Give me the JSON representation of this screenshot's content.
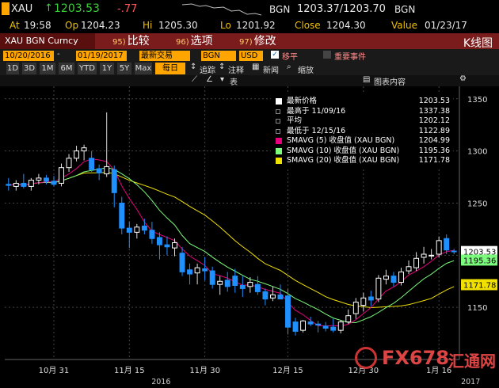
{
  "header": {
    "symbol": "XAU",
    "arrow": "↑",
    "price": "1203.53",
    "change": "-.77",
    "bid_label": "BGN",
    "bid_ask": "1203.37/1203.70",
    "ask_label": "BGN"
  },
  "quote": {
    "at_label": "At",
    "at_value": "19:58",
    "op_label": "Op",
    "op_value": "1204.23",
    "hi_label": "Hi",
    "hi_value": "1205.30",
    "lo_label": "Lo",
    "lo_value": "1201.92",
    "close_label": "Close",
    "close_value": "1204.30",
    "value_label": "Value",
    "value_date": "01/23/17"
  },
  "menu": {
    "security": "XAU BGN Curncy",
    "compare_num": "95)",
    "compare": "比较",
    "options_num": "96)",
    "options": "选项",
    "edit_num": "97)",
    "edit": "修改",
    "right_title": "K线图"
  },
  "settings": {
    "start_date": "10/20/2016",
    "end_date": "01/19/2017",
    "mode": "最新交易",
    "source": "BGN",
    "currency": "USD",
    "shift_label": "移平",
    "events_label": "重要事件"
  },
  "periods": {
    "items": [
      "1D",
      "3D",
      "1M",
      "6M",
      "YTD",
      "1Y",
      "5Y",
      "Max"
    ],
    "freq": "每日",
    "track": "追踪",
    "note": "注释",
    "news": "新闻",
    "zoom": "缩放",
    "table": "表",
    "chart_content": "图表内容"
  },
  "legend": {
    "items": [
      {
        "label": "最新价格",
        "value": "1203.53",
        "color": "#ffffff"
      },
      {
        "label": "最高于 11/09/16",
        "value": "1337.38",
        "color": ""
      },
      {
        "label": "平均",
        "value": "1202.12",
        "color": ""
      },
      {
        "label": "最低于 12/15/16",
        "value": "1122.89",
        "color": ""
      },
      {
        "label": "SMAVG (5) 收盘值 (XAU BGN)",
        "value": "1204.99",
        "color": "#e6007e"
      },
      {
        "label": "SMAVG (10) 收盘值 (XAU BGN)",
        "value": "1195.36",
        "color": "#7cfc7c"
      },
      {
        "label": "SMAVG (20) 收盘值 (XAU BGN)",
        "value": "1171.78",
        "color": "#f0e000"
      }
    ]
  },
  "watermark": {
    "text1": "FX678",
    "text2": "汇通网"
  },
  "colors": {
    "up": "#ffffff",
    "down": "#1e90ff",
    "sma5": "#e6007e",
    "sma10": "#7cfc7c",
    "sma20": "#f0e000",
    "grid": "#444444"
  },
  "chart_data": {
    "type": "candlestick",
    "title": "",
    "ylim": [
      1100,
      1362
    ],
    "yticks": [
      1150,
      1200,
      1250,
      1300,
      1350
    ],
    "xlabels": [
      "10月 31",
      "11月 15",
      "11月 30",
      "12月 15",
      "12月 30",
      "1月 16"
    ],
    "year_labels": [
      "2016",
      "2017"
    ],
    "last_price_label": "1203.53",
    "sma10_label": "1195.36",
    "sma20_label": "1171.78",
    "candles": [
      {
        "o": 1268,
        "h": 1274,
        "l": 1262,
        "c": 1267
      },
      {
        "o": 1266,
        "h": 1272,
        "l": 1262,
        "c": 1269
      },
      {
        "o": 1269,
        "h": 1278,
        "l": 1264,
        "c": 1266
      },
      {
        "o": 1266,
        "h": 1274,
        "l": 1262,
        "c": 1272
      },
      {
        "o": 1272,
        "h": 1278,
        "l": 1268,
        "c": 1274
      },
      {
        "o": 1274,
        "h": 1277,
        "l": 1268,
        "c": 1271
      },
      {
        "o": 1271,
        "h": 1276,
        "l": 1266,
        "c": 1268
      },
      {
        "o": 1269,
        "h": 1288,
        "l": 1266,
        "c": 1284
      },
      {
        "o": 1284,
        "h": 1297,
        "l": 1280,
        "c": 1293
      },
      {
        "o": 1293,
        "h": 1305,
        "l": 1290,
        "c": 1300
      },
      {
        "o": 1300,
        "h": 1306,
        "l": 1291,
        "c": 1303
      },
      {
        "o": 1293,
        "h": 1300,
        "l": 1280,
        "c": 1282
      },
      {
        "o": 1283,
        "h": 1287,
        "l": 1272,
        "c": 1279
      },
      {
        "o": 1278,
        "h": 1337,
        "l": 1275,
        "c": 1285
      },
      {
        "o": 1282,
        "h": 1286,
        "l": 1246,
        "c": 1260
      },
      {
        "o": 1250,
        "h": 1256,
        "l": 1220,
        "c": 1226
      },
      {
        "o": 1226,
        "h": 1232,
        "l": 1207,
        "c": 1222
      },
      {
        "o": 1222,
        "h": 1230,
        "l": 1216,
        "c": 1227
      },
      {
        "o": 1228,
        "h": 1235,
        "l": 1220,
        "c": 1224
      },
      {
        "o": 1224,
        "h": 1232,
        "l": 1211,
        "c": 1216
      },
      {
        "o": 1217,
        "h": 1222,
        "l": 1196,
        "c": 1210
      },
      {
        "o": 1210,
        "h": 1218,
        "l": 1200,
        "c": 1208
      },
      {
        "o": 1207,
        "h": 1216,
        "l": 1199,
        "c": 1212
      },
      {
        "o": 1202,
        "h": 1208,
        "l": 1180,
        "c": 1184
      },
      {
        "o": 1186,
        "h": 1192,
        "l": 1172,
        "c": 1182
      },
      {
        "o": 1183,
        "h": 1192,
        "l": 1172,
        "c": 1188
      },
      {
        "o": 1187,
        "h": 1198,
        "l": 1176,
        "c": 1185
      },
      {
        "o": 1185,
        "h": 1189,
        "l": 1168,
        "c": 1172
      },
      {
        "o": 1172,
        "h": 1180,
        "l": 1162,
        "c": 1175
      },
      {
        "o": 1176,
        "h": 1184,
        "l": 1165,
        "c": 1170
      },
      {
        "o": 1180,
        "h": 1187,
        "l": 1164,
        "c": 1171
      },
      {
        "o": 1171,
        "h": 1180,
        "l": 1160,
        "c": 1168
      },
      {
        "o": 1170,
        "h": 1179,
        "l": 1164,
        "c": 1174
      },
      {
        "o": 1172,
        "h": 1180,
        "l": 1162,
        "c": 1165
      },
      {
        "o": 1165,
        "h": 1168,
        "l": 1152,
        "c": 1158
      },
      {
        "o": 1159,
        "h": 1170,
        "l": 1156,
        "c": 1162
      },
      {
        "o": 1162,
        "h": 1172,
        "l": 1158,
        "c": 1158
      },
      {
        "o": 1161,
        "h": 1168,
        "l": 1124,
        "c": 1131
      },
      {
        "o": 1136,
        "h": 1140,
        "l": 1123,
        "c": 1127
      },
      {
        "o": 1128,
        "h": 1138,
        "l": 1126,
        "c": 1137
      },
      {
        "o": 1136,
        "h": 1141,
        "l": 1132,
        "c": 1134
      },
      {
        "o": 1134,
        "h": 1137,
        "l": 1126,
        "c": 1133
      },
      {
        "o": 1132,
        "h": 1136,
        "l": 1127,
        "c": 1130
      },
      {
        "o": 1131,
        "h": 1139,
        "l": 1126,
        "c": 1128
      },
      {
        "o": 1128,
        "h": 1138,
        "l": 1125,
        "c": 1136
      },
      {
        "o": 1136,
        "h": 1148,
        "l": 1134,
        "c": 1142
      },
      {
        "o": 1144,
        "h": 1159,
        "l": 1139,
        "c": 1155
      },
      {
        "o": 1152,
        "h": 1164,
        "l": 1146,
        "c": 1159
      },
      {
        "o": 1160,
        "h": 1166,
        "l": 1151,
        "c": 1157
      },
      {
        "o": 1158,
        "h": 1181,
        "l": 1155,
        "c": 1178
      },
      {
        "o": 1177,
        "h": 1186,
        "l": 1172,
        "c": 1180
      },
      {
        "o": 1180,
        "h": 1184,
        "l": 1170,
        "c": 1174
      },
      {
        "o": 1174,
        "h": 1188,
        "l": 1171,
        "c": 1184
      },
      {
        "o": 1185,
        "h": 1195,
        "l": 1182,
        "c": 1189
      },
      {
        "o": 1188,
        "h": 1203,
        "l": 1185,
        "c": 1197
      },
      {
        "o": 1198,
        "h": 1208,
        "l": 1192,
        "c": 1201
      },
      {
        "o": 1200,
        "h": 1206,
        "l": 1196,
        "c": 1200
      },
      {
        "o": 1201,
        "h": 1218,
        "l": 1198,
        "c": 1214
      },
      {
        "o": 1216,
        "h": 1220,
        "l": 1201,
        "c": 1205
      },
      {
        "o": 1204,
        "h": 1206,
        "l": 1201,
        "c": 1203.5
      }
    ]
  }
}
